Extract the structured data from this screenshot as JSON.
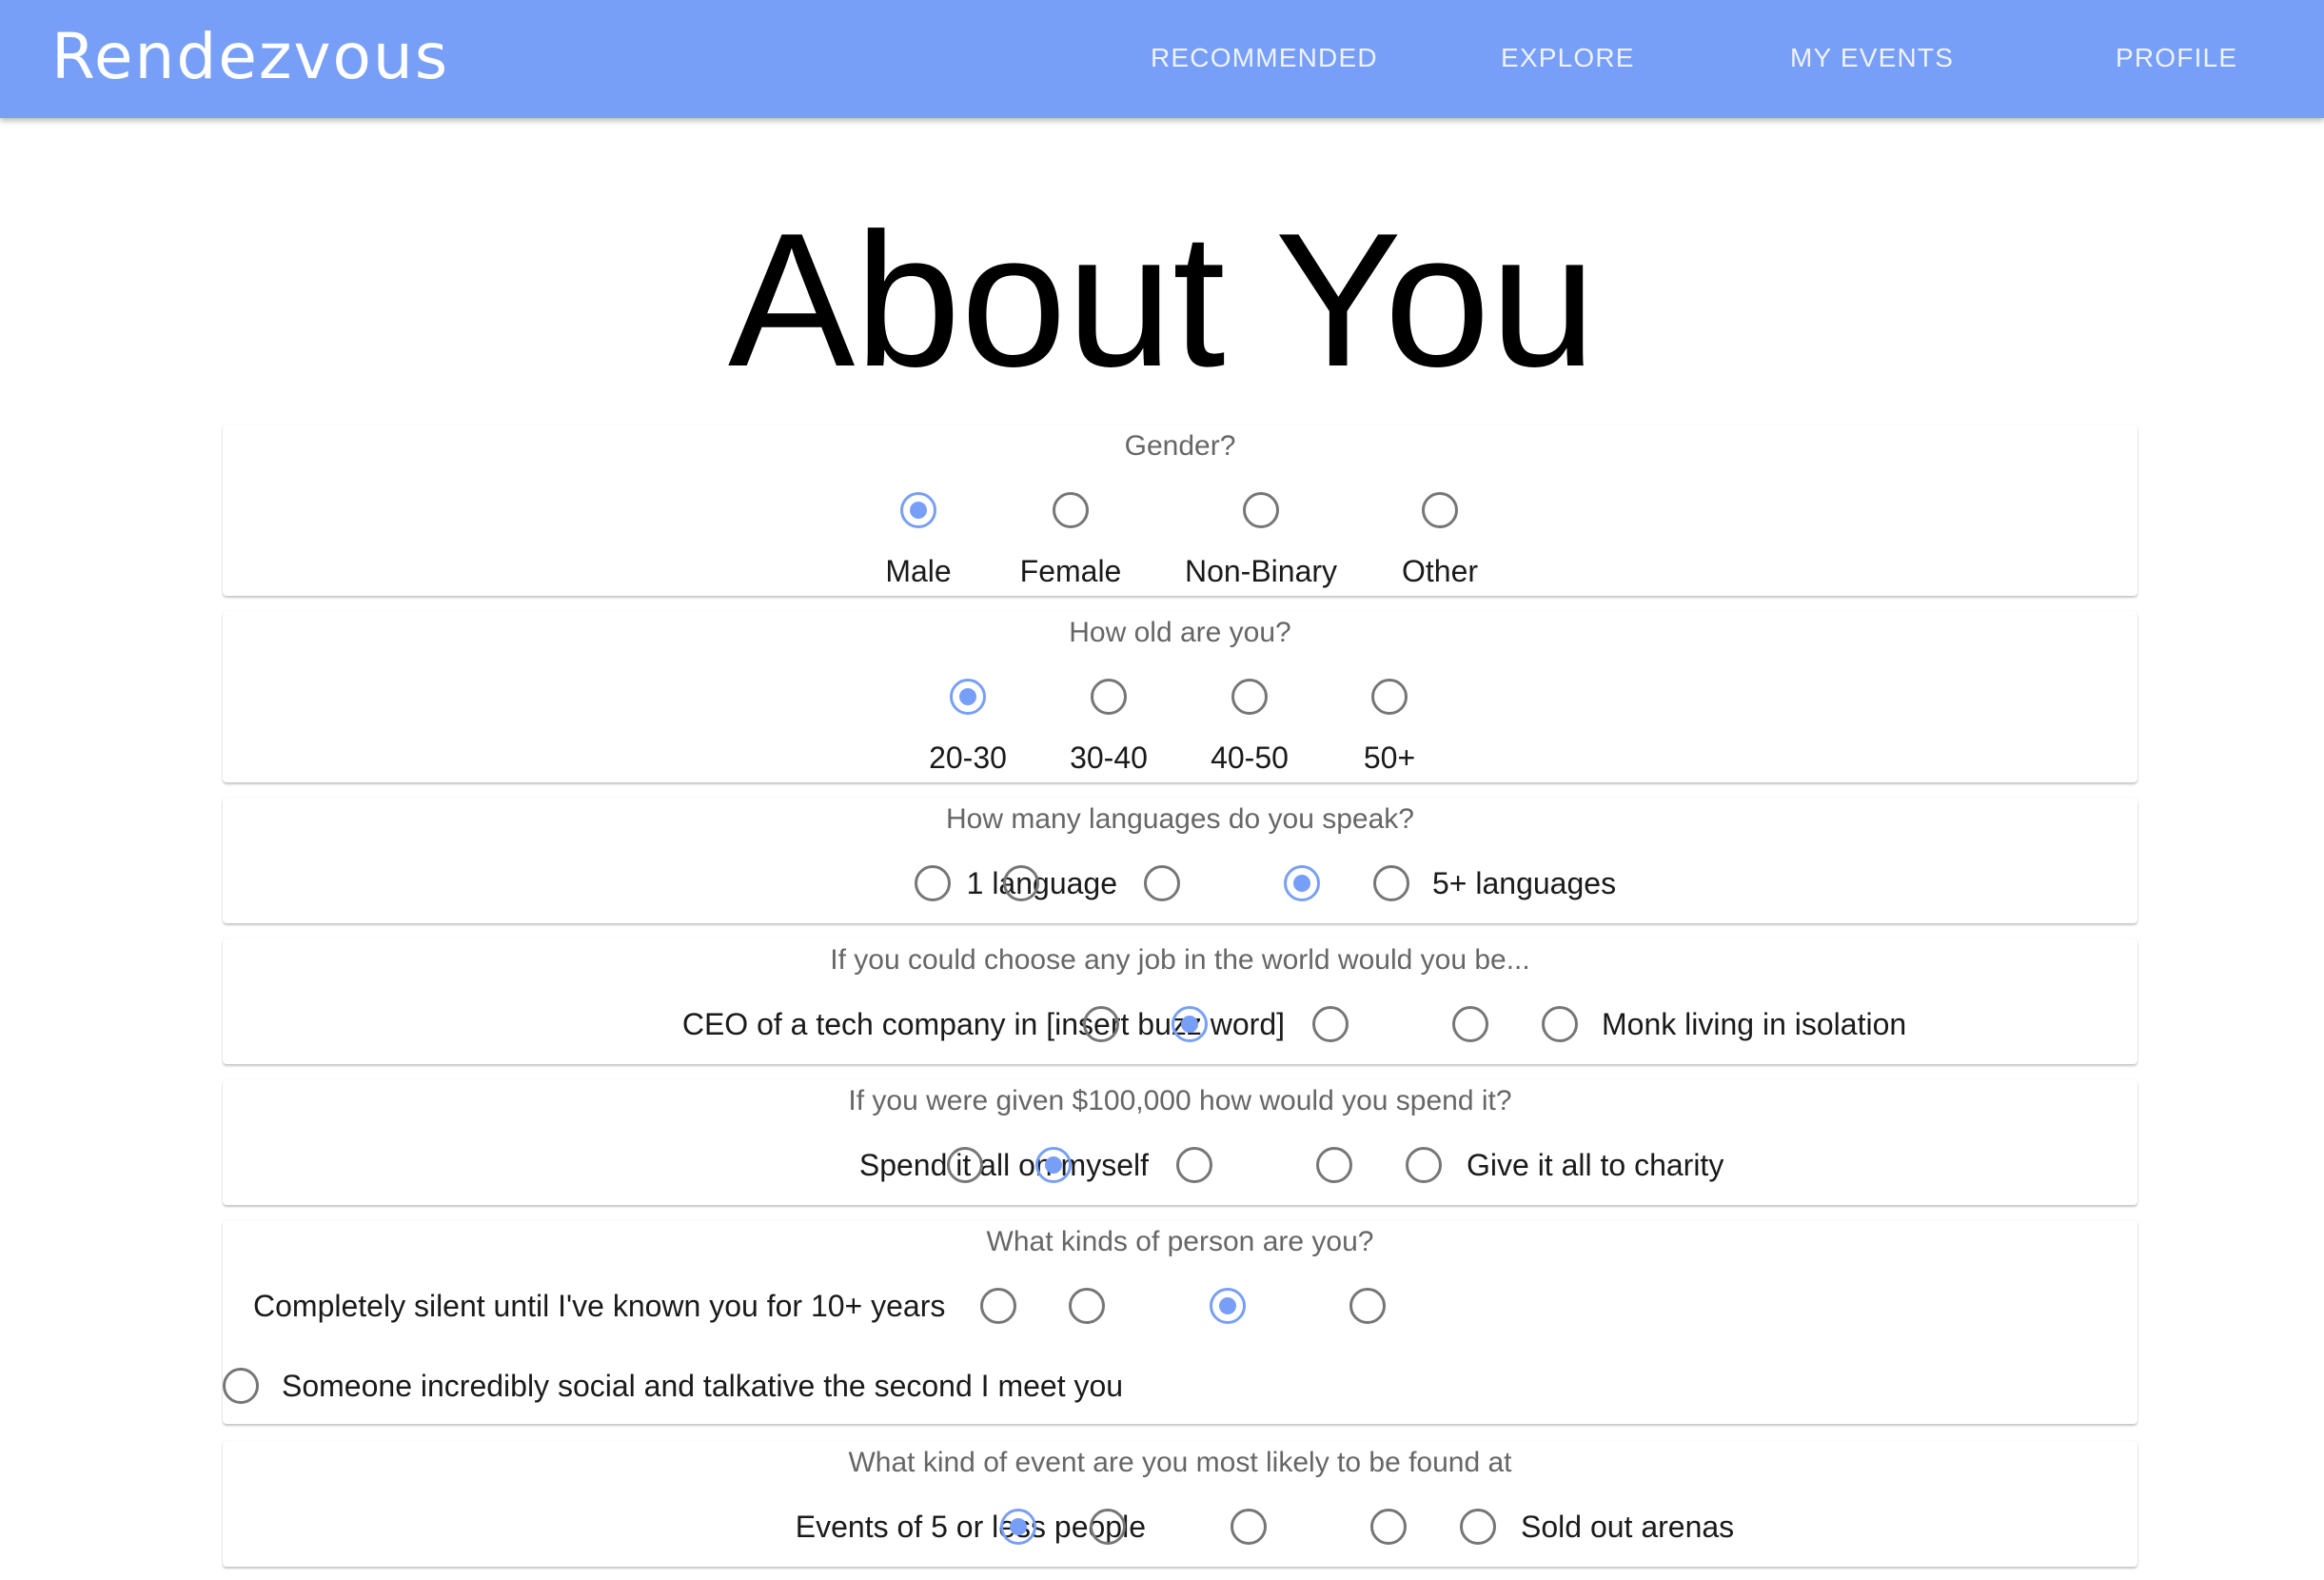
{
  "app": {
    "logo": "Rendezvous"
  },
  "nav": {
    "items": [
      "RECOMMENDED",
      "EXPLORE",
      "MY EVENTS",
      "PROFILE"
    ]
  },
  "page": {
    "title": "About You"
  },
  "colors": {
    "navbar": "#779ff8",
    "radio_selected": "#779ff8",
    "radio_unselected": "#767676"
  },
  "questions": [
    {
      "label": "Gender?",
      "options": [
        "Male",
        "Female",
        "Non-Binary",
        "Other"
      ],
      "selected": "Male"
    },
    {
      "label": "How old are you?",
      "options": [
        "20-30",
        "30-40",
        "40-50",
        "50+"
      ],
      "selected": "20-30"
    },
    {
      "label": "How many languages do you speak?",
      "min_label": "1 language",
      "max_label": "5+ languages",
      "scale_points": 5,
      "selected_point": 4
    },
    {
      "label": "If you could choose any job in the world would you be...",
      "min_label": "CEO of a tech company in [insert buzz word]",
      "max_label": "Monk living in isolation",
      "scale_points": 5,
      "selected_point": 2
    },
    {
      "label": "If you were given $100,000 how would you spend it?",
      "min_label": "Spend it all on myself",
      "max_label": "Give it all to charity",
      "scale_points": 5,
      "selected_point": 2
    },
    {
      "label": "What kinds of person are you?",
      "min_label": "Completely silent until I've known you for 10+ years",
      "max_label": "Someone incredibly social and talkative the second I meet you",
      "scale_points": 5,
      "selected_point": 3
    },
    {
      "label": "What kind of event are you most likely to be found at",
      "min_label": "Events of 5 or less people",
      "max_label": "Sold out arenas",
      "scale_points": 5,
      "selected_point": 1
    }
  ]
}
